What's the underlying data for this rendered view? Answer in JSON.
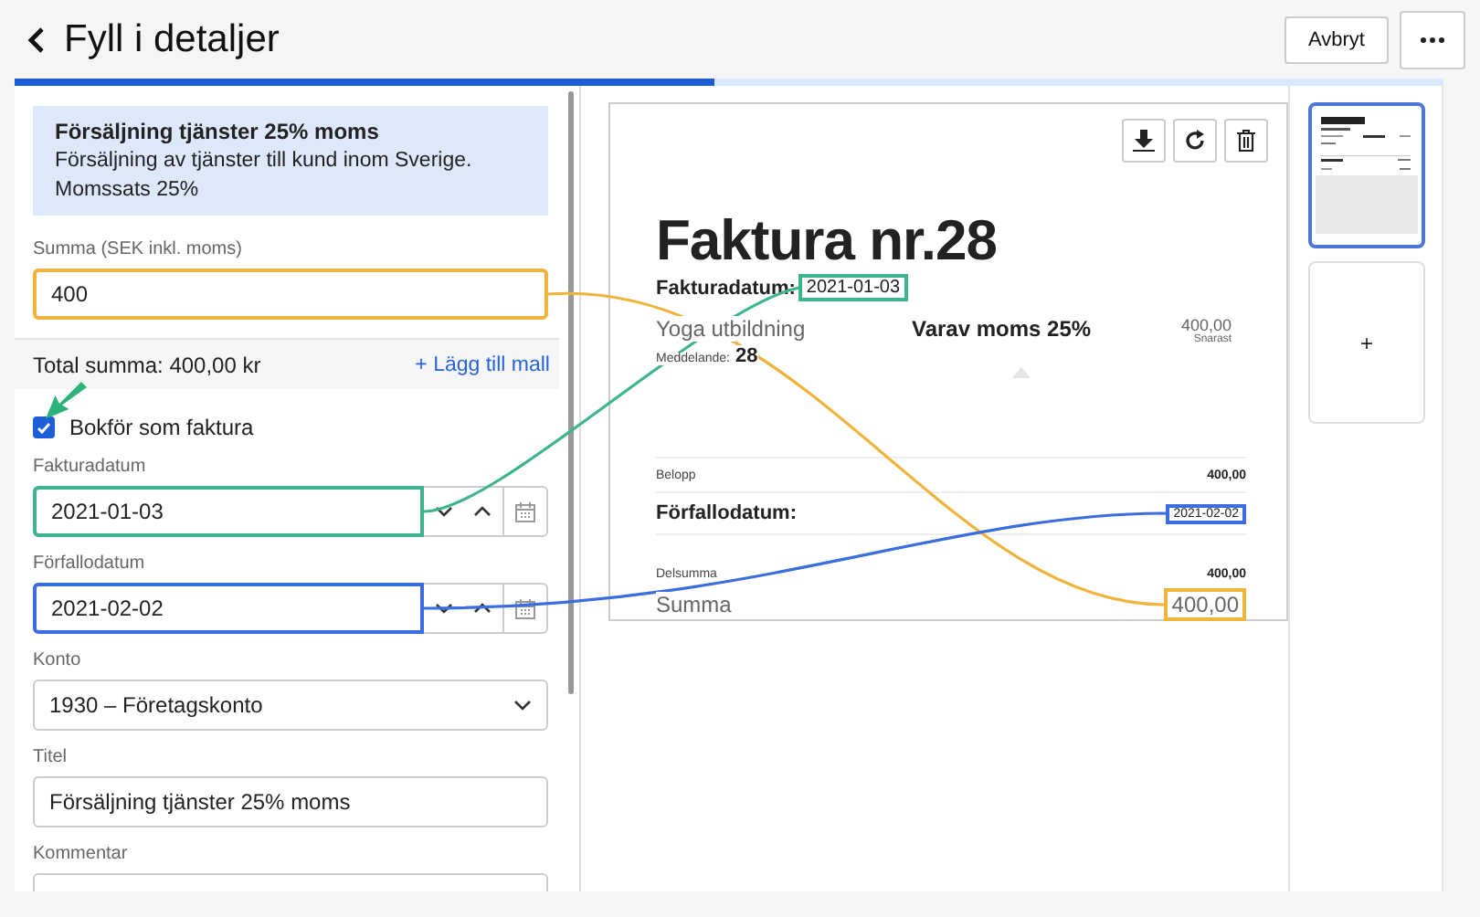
{
  "header": {
    "title": "Fyll i detaljer",
    "cancel": "Avbryt"
  },
  "progress": {
    "level": 0.49
  },
  "template_info": {
    "title": "Försäljning tjänster 25% moms",
    "description": "Försäljning av tjänster till kund inom Sverige. Momssats 25%"
  },
  "amount_field": {
    "label": "Summa (SEK inkl. moms)",
    "value": "400",
    "color": "#f0b43c"
  },
  "total": {
    "text": "Total summa: 400,00 kr",
    "link": "+ Lägg till mall"
  },
  "invoice_checkbox": {
    "label": "Bokför som faktura",
    "checked": true
  },
  "fields": [
    {
      "kind": "date",
      "label": "Fakturadatum",
      "value": "2021-01-03",
      "color": "#3db58a"
    },
    {
      "kind": "date",
      "label": "Förfallodatum",
      "value": "2021-02-02",
      "color": "#3a6ee0"
    },
    {
      "kind": "select",
      "label": "Konto",
      "value": "1930 – Företagskonto"
    },
    {
      "kind": "text",
      "label": "Titel",
      "value": "Försäljning tjänster 25% moms"
    },
    {
      "kind": "text",
      "label": "Kommentar"
    }
  ],
  "document": {
    "title": "Faktura nr.28",
    "date_label": "Fakturadatum:",
    "date": "2021-01-03",
    "customer": "Yoga utbildning",
    "vat_label": "Varav moms 25%",
    "amount": "400,00",
    "due_note": "Snarast",
    "message_label": "Meddelande:",
    "message": "28",
    "amount_row": {
      "label": "Belopp",
      "value": "400,00"
    },
    "due_row": {
      "label": "Förfallodatum:",
      "value": "2021-02-02"
    },
    "subtotal": {
      "label": "Delsumma",
      "value": "400,00"
    },
    "total": {
      "label": "Summa",
      "value": "400,00"
    }
  },
  "pages": [
    {
      "kind": "page",
      "selected": true
    },
    {
      "kind": "add",
      "label": "+",
      "selected": false
    }
  ]
}
